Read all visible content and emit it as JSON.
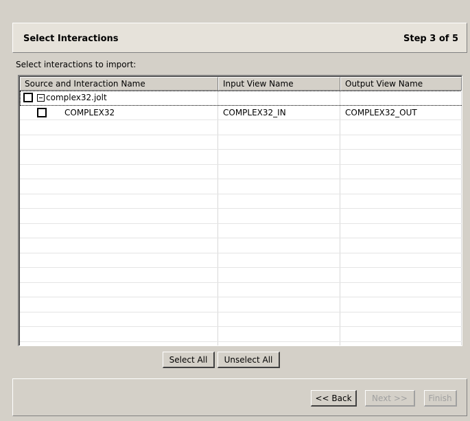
{
  "header": {
    "title": "Select Interactions",
    "step": "Step 3 of 5"
  },
  "instruction": "Select interactions to import:",
  "table": {
    "columns": [
      "Source and Interaction Name",
      "Input View Name",
      "Output View Name"
    ],
    "source": {
      "name": "complex32.jolt",
      "checked": false,
      "expanded": true
    },
    "interaction": {
      "name": "COMPLEX32",
      "input_view": "COMPLEX32_IN",
      "output_view": "COMPLEX32_OUT",
      "checked": false
    }
  },
  "buttons": {
    "select_all": "Select All",
    "unselect_all": "Unselect All",
    "back": "<< Back",
    "next": "Next >>",
    "finish": "Finish"
  },
  "colors": {
    "background": "#d4d0c8",
    "header_background": "#e6e2da",
    "table_background": "#ffffff",
    "disabled_text": "#a0a0a0"
  }
}
